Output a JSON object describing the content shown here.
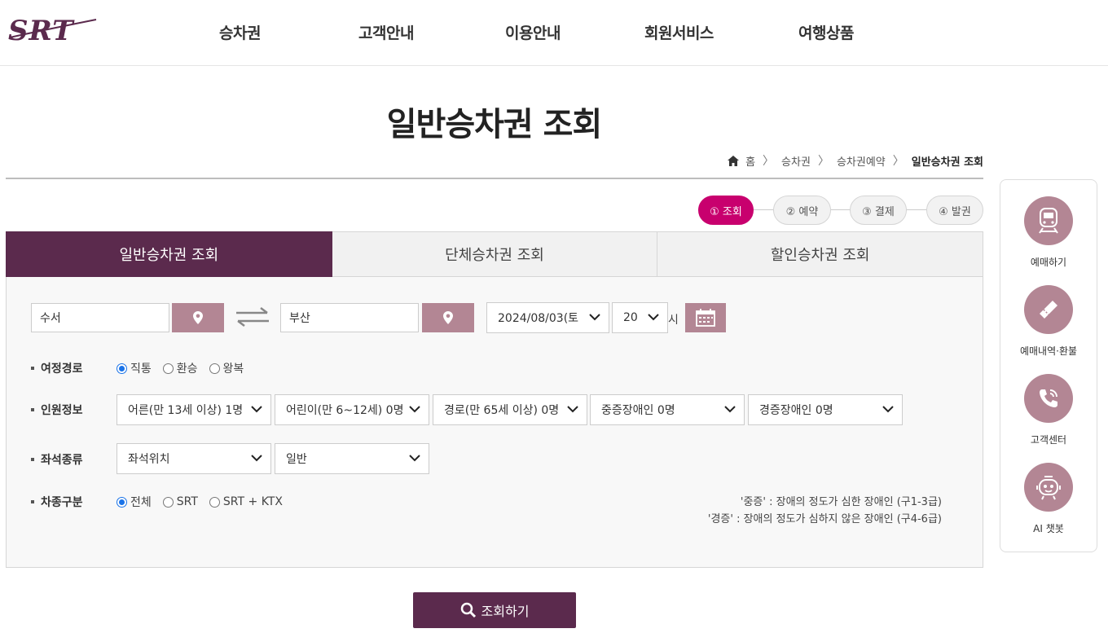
{
  "brand": {
    "logo_text": "SRT",
    "accent": "#5b2a4d",
    "active_step_color": "#c8006e",
    "button_color": "#b38694"
  },
  "nav": [
    "승차권",
    "고객안내",
    "이용안내",
    "회원서비스",
    "여행상품"
  ],
  "page": {
    "title": "일반승차권 조회"
  },
  "breadcrumb": {
    "home": "홈",
    "items": [
      "승차권",
      "승차권예약"
    ],
    "current": "일반승차권 조회"
  },
  "steps": [
    "① 조회",
    "② 예약",
    "③ 결제",
    "④ 발권"
  ],
  "tabs": [
    "일반승차권 조회",
    "단체승차권 조회",
    "할인승차권 조회"
  ],
  "search": {
    "departure": "수서",
    "arrival": "부산",
    "date": "2024/08/03(토",
    "hour": "20",
    "hour_unit": "시"
  },
  "route": {
    "label": "여정경로",
    "options": [
      "직통",
      "환승",
      "왕복"
    ],
    "selected": "직통"
  },
  "passengers": {
    "label": "인원정보",
    "selects": [
      "어른(만 13세 이상) 1명",
      "어린이(만 6~12세) 0명",
      "경로(만 65세 이상) 0명",
      "중증장애인 0명",
      "경증장애인 0명"
    ]
  },
  "seat": {
    "label": "좌석종류",
    "selects": [
      "좌석위치",
      "일반"
    ]
  },
  "train_type": {
    "label": "차종구분",
    "options": [
      "전체",
      "SRT",
      "SRT + KTX"
    ],
    "selected": "전체"
  },
  "notes": [
    "'중증' : 장애의 정도가 심한 장애인 (구1-3급)",
    "'경증' : 장애의 정도가 심하지 않은 장애인 (구4-6급)"
  ],
  "search_button": "조회하기",
  "quick_menu": [
    {
      "label": "예매하기",
      "icon": "train-icon"
    },
    {
      "label": "예매내역·환불",
      "icon": "ticket-icon"
    },
    {
      "label": "고객센터",
      "icon": "phone-icon"
    },
    {
      "label": "AI 챗봇",
      "icon": "chatbot-icon"
    }
  ]
}
